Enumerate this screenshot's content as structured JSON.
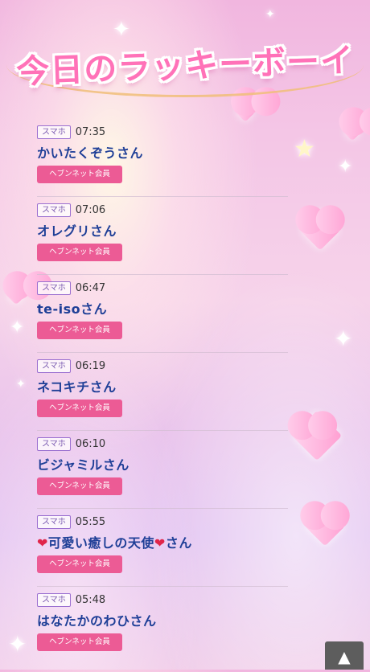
{
  "title": "今日のラッキーボーイ",
  "entries": [
    {
      "device": "スマホ",
      "time": "07:35",
      "name": "かいたくぞうさん",
      "member": "ヘブンネット会員"
    },
    {
      "device": "スマホ",
      "time": "07:06",
      "name": "オレグリさん",
      "member": "ヘブンネット会員"
    },
    {
      "device": "スマホ",
      "time": "06:47",
      "name": "te-isoさん",
      "member": "ヘブンネット会員"
    },
    {
      "device": "スマホ",
      "time": "06:19",
      "name": "ネコキチさん",
      "member": "ヘブンネット会員"
    },
    {
      "device": "スマホ",
      "time": "06:10",
      "name": "ビジャミルさん",
      "member": "ヘブンネット会員"
    },
    {
      "device": "スマホ",
      "time": "05:55",
      "name_prefix": "❤",
      "name_core": "可愛い癒しの天使",
      "name_suffix_heart": "❤",
      "name_suffix": "さん",
      "member": "ヘブンネット会員"
    },
    {
      "device": "スマホ",
      "time": "05:48",
      "name": "はなたかのわひさん",
      "member": "ヘブンネット会員"
    }
  ],
  "back_to_top": "▲",
  "icons": {
    "back_to_top": "arrow-up-icon",
    "heart": "heart-icon",
    "sparkle": "sparkle-icon"
  },
  "colors": {
    "title": "#ff72b8",
    "name": "#1f3f97",
    "member_badge": "#ec5b95",
    "device_badge": "#9a6fd0"
  }
}
